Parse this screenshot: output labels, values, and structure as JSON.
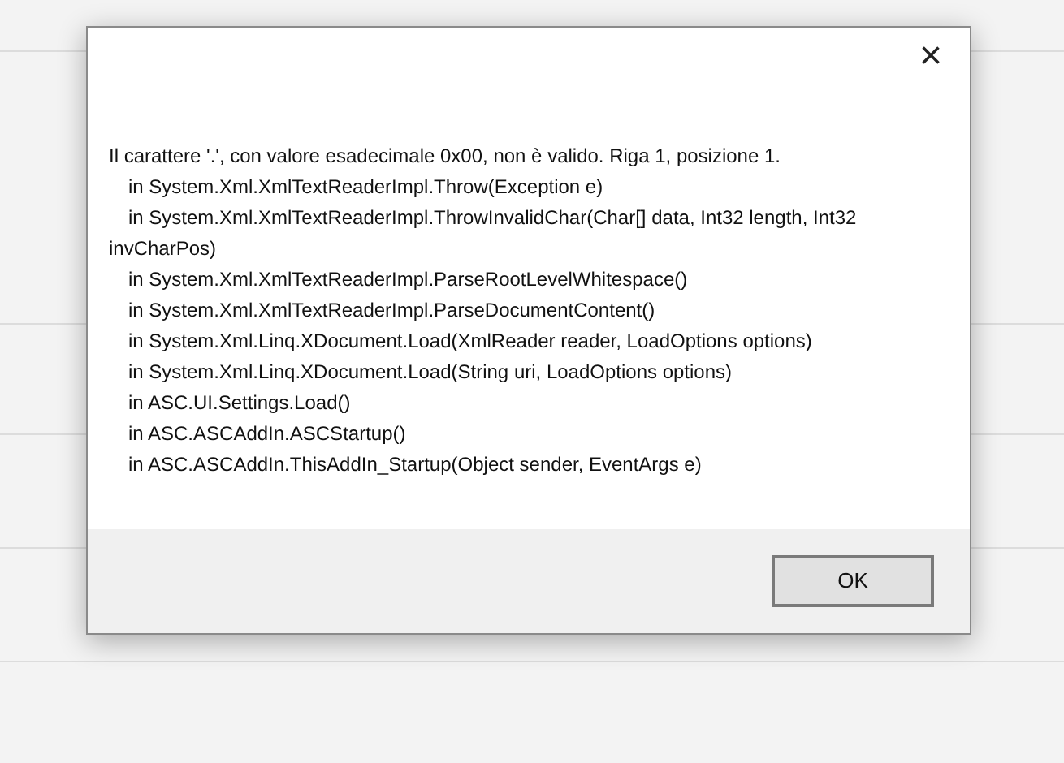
{
  "dialog": {
    "close": "×",
    "message": "Il carattere '.', con valore esadecimale 0x00, non è valido. Riga 1, posizione 1.",
    "stack_trace": [
      "in System.Xml.XmlTextReaderImpl.Throw(Exception e)",
      "in System.Xml.XmlTextReaderImpl.ThrowInvalidChar(Char[] data, Int32 length, Int32 invCharPos)",
      "in System.Xml.XmlTextReaderImpl.ParseRootLevelWhitespace()",
      "in System.Xml.XmlTextReaderImpl.ParseDocumentContent()",
      "in System.Xml.Linq.XDocument.Load(XmlReader reader, LoadOptions options)",
      "in System.Xml.Linq.XDocument.Load(String uri, LoadOptions options)",
      "in ASC.UI.Settings.Load()",
      "in ASC.ASCAddIn.ASCStartup()",
      "in ASC.ASCAddIn.ThisAddIn_Startup(Object sender, EventArgs e)"
    ],
    "buttons": [
      "OK"
    ]
  }
}
